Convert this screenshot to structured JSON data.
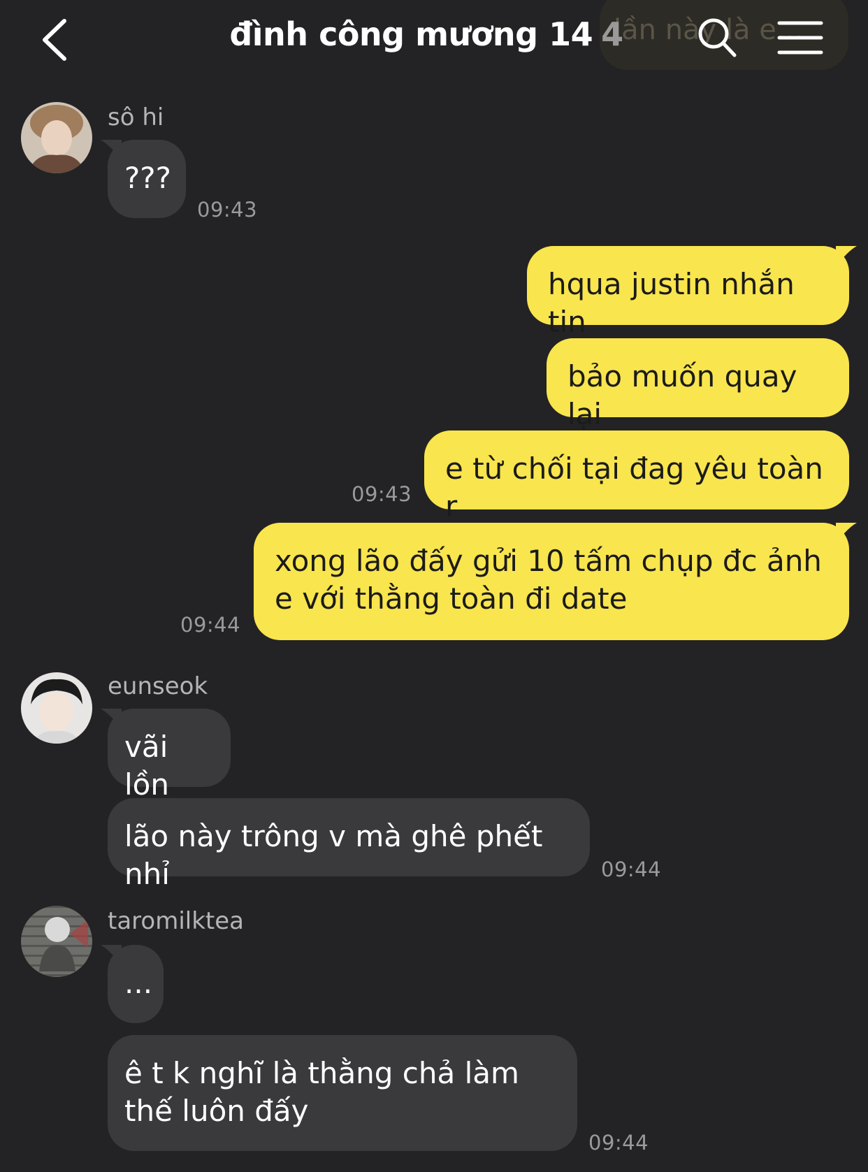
{
  "header": {
    "title": "đình công mương 14",
    "member_count": "4",
    "ghost_preview": "lần này là e..."
  },
  "messages": {
    "m1": {
      "sender": "sô hi",
      "text": "???",
      "time": "09:43"
    },
    "m2": {
      "texts": [
        "hqua justin nhắn tin",
        "bảo muốn quay lại",
        "e từ chối tại đag yêu toàn r"
      ],
      "time": "09:43"
    },
    "m3": {
      "text": "xong lão đấy gửi 10 tấm chụp đc ảnh e với thằng toàn đi date",
      "time": "09:44"
    },
    "m4": {
      "sender": "eunseok",
      "texts": [
        "vãi lồn",
        "lão này trông v mà ghê phết nhỉ"
      ],
      "time": "09:44"
    },
    "m5": {
      "sender": "taromilktea",
      "texts": [
        "...",
        "ê t k nghĩ là thằng chả làm thế luôn đấy"
      ],
      "time": "09:44"
    }
  },
  "colors": {
    "background": "#232325",
    "bubble_in": "#3a3a3c",
    "bubble_out": "#f9e54d"
  },
  "icons": [
    "back-icon",
    "search-icon",
    "menu-icon"
  ]
}
